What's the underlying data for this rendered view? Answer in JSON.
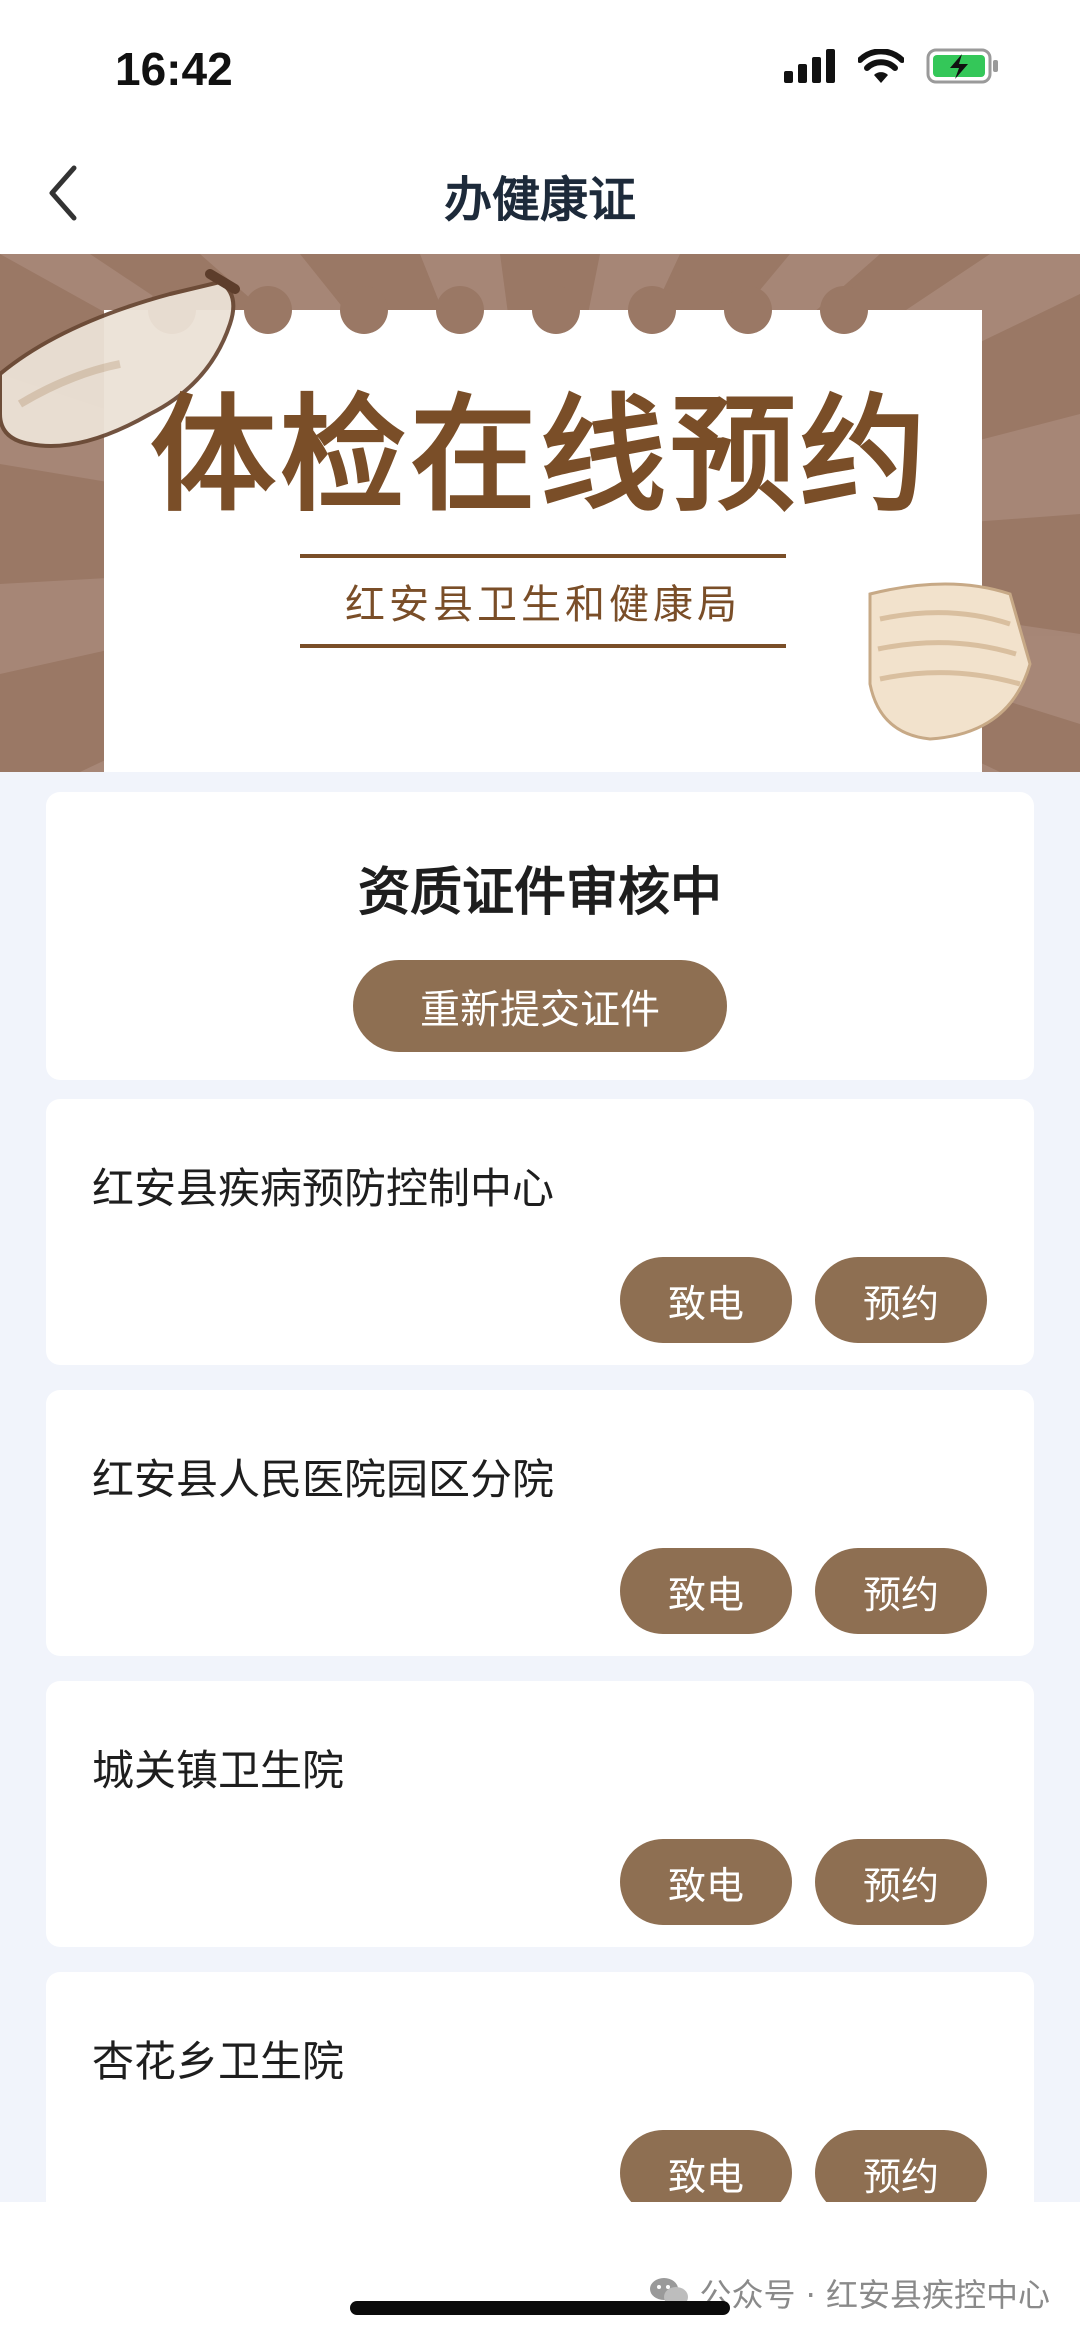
{
  "status_bar": {
    "time": "16:42"
  },
  "nav": {
    "title": "办健康证"
  },
  "banner": {
    "headline": "体检在线预约",
    "subtitle": "红安县卫生和健康局"
  },
  "review": {
    "status_text": "资质证件审核中",
    "resubmit_label": "重新提交证件"
  },
  "hospitals": [
    {
      "name": "红安县疾病预防控制中心",
      "call_label": "致电",
      "book_label": "预约"
    },
    {
      "name": "红安县人民医院园区分院",
      "call_label": "致电",
      "book_label": "预约"
    },
    {
      "name": "城关镇卫生院",
      "call_label": "致电",
      "book_label": "预约"
    },
    {
      "name": "杏花乡卫生院",
      "call_label": "致电",
      "book_label": "预约"
    }
  ],
  "watermark": {
    "text": "公众号 · 红安县疾控中心"
  },
  "colors": {
    "accent": "#8e6f52",
    "banner_bg": "#9a7865",
    "headline": "#7a4e28"
  },
  "icons": [
    "back-chevron-icon",
    "signal-icon",
    "wifi-icon",
    "battery-charging-icon",
    "wechat-icon"
  ]
}
